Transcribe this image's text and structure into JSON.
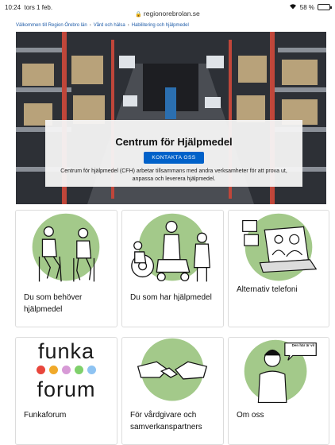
{
  "status_bar": {
    "time": "10:24",
    "date": "tors 1 feb.",
    "battery": "58 %",
    "battery_level": 0.58,
    "wifi_icon": "wifi-icon"
  },
  "browser": {
    "url": "regionorebrolan.se"
  },
  "breadcrumb": [
    "Välkommen till Region Örebro län",
    "Vård och hälsa",
    "Habilitering och hjälpmedel"
  ],
  "hero": {
    "title": "Centrum för Hjälpmedel",
    "button_label": "KONTAKTA OSS",
    "description": "Centrum för hjälpmedel (CFH) arbetar tillsammans med andra verksamheter för att prova ut, anpassa och leverera hjälpmedel."
  },
  "cards": [
    {
      "label": "Du som behöver hjälpmedel"
    },
    {
      "label": "Du som har hjälpmedel"
    },
    {
      "label": "Alternativ telefoni"
    },
    {
      "label": "Funkaforum",
      "logo_top": "funka",
      "logo_bottom": "forum",
      "logo_dot_colors": [
        "#e8463c",
        "#f0a92a",
        "#d79ad6",
        "#7fd06b",
        "#8ec3f2"
      ]
    },
    {
      "label": "För vårdgivare och samverkanspartners"
    },
    {
      "label": "Om oss",
      "speech_bubble": "Den här är vi!"
    }
  ],
  "colors": {
    "accent": "#0061c9",
    "illustration_green": "#a3c98a",
    "link": "#1f5ca8"
  }
}
